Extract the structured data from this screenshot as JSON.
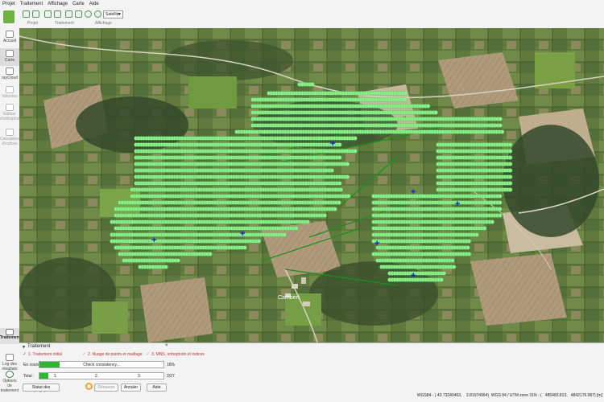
{
  "menu": [
    "Projet",
    "Traitement",
    "Affichage",
    "Carte",
    "Aide"
  ],
  "toolbar": {
    "groups": [
      "Projet",
      "Traitement",
      "Affichage"
    ],
    "map_type": "Satellite"
  },
  "sidebar": {
    "items": [
      {
        "label": "Accueil",
        "icon": "home-icon"
      },
      {
        "label": "Carte",
        "icon": "map-icon",
        "active": true
      },
      {
        "label": "rayCloud",
        "icon": "raycloud-icon"
      },
      {
        "label": "Volumes",
        "icon": "volumes-icon",
        "disabled": true
      },
      {
        "label": "Éditeur d'orthophoto",
        "icon": "mosaic-icon",
        "disabled": true
      },
      {
        "label": "Calculateur d'indices",
        "icon": "index-icon",
        "disabled": true
      }
    ],
    "bottom": [
      {
        "label": "Traitement",
        "icon": "processing-icon"
      },
      {
        "label": "Log des résultats",
        "icon": "log-icon"
      },
      {
        "label": "Options de traitement",
        "icon": "gear-icon"
      }
    ]
  },
  "map": {
    "place_label": "Cambert",
    "point_color": "#8cf08c",
    "gcp_color": "#1020c8",
    "line_color": "#1a8f1a"
  },
  "processing": {
    "title": "Traitement",
    "steps": [
      {
        "label": "1. Traitement initial",
        "checked": true
      },
      {
        "label": "2. Nuage de points et maillage",
        "checked": false
      },
      {
        "label": "3. MNS, orthophoto et indices",
        "checked": false
      }
    ],
    "current_label": "En cours :",
    "current_task": "Check consistency...",
    "current_percent": "16%",
    "current_progress": 0.16,
    "total_label": "Total :",
    "total_segments": [
      "1.",
      "2.",
      "3."
    ],
    "total_count": "2/27",
    "total_progress": 0.07,
    "buttons": {
      "status": "Statut des résultats...",
      "start": "Démarrer",
      "cancel": "Annuler",
      "help": "Aide"
    }
  },
  "statusbar": {
    "coords": "WGS84 - ( 43.73240463,    2.81974964)  WGS 84 / UTM zone 31N - (   485483.813,   4842176.087) [m]"
  }
}
